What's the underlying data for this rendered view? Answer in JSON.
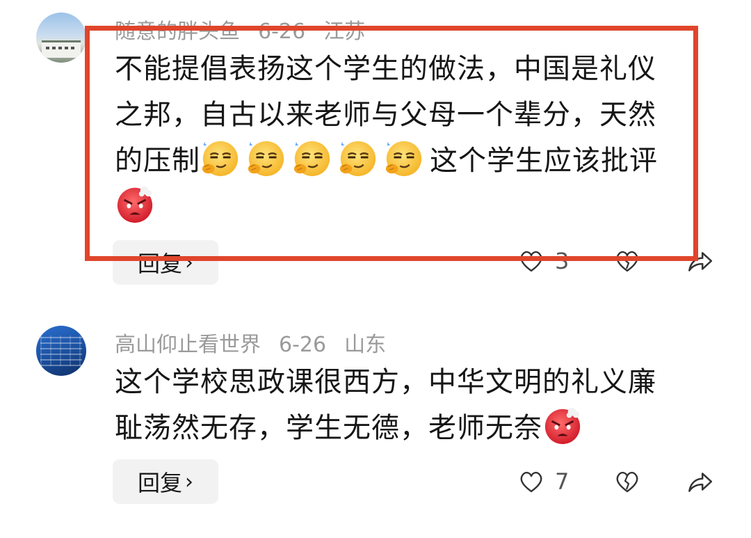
{
  "comments": [
    {
      "username": "随意的胖头鱼",
      "date": "6-26",
      "location": "江苏",
      "text_lines": [
        "不能提倡表扬这个学生的做法，中国是礼仪",
        "之邦，自古以来老师与父母一个辈分，天然"
      ],
      "text_line3_before": "的压制",
      "text_line3_after": "这个学生应该批评",
      "emojis": [
        "smug-face-emoji",
        "smug-face-emoji",
        "smug-face-emoji",
        "smug-face-emoji",
        "smug-face-emoji",
        "angry-face-emoji"
      ],
      "reply_label": "回复",
      "like_count": "3"
    },
    {
      "username": "高山仰止看世界",
      "date": "6-26",
      "location": "山东",
      "text_lines": [
        "这个学校思政课很西方，中华文明的礼义廉"
      ],
      "text_line2": "耻荡然无存，学生无德，老师无奈",
      "emojis": [
        "angry-face-emoji"
      ],
      "reply_label": "回复",
      "like_count": "7"
    }
  ],
  "colors": {
    "highlight_border": "#e0452b",
    "meta_text": "#9a9a9a",
    "reply_bg": "#f2f2f2"
  },
  "icons": [
    "heart-icon",
    "broken-heart-icon",
    "share-icon",
    "chevron-right-icon"
  ]
}
